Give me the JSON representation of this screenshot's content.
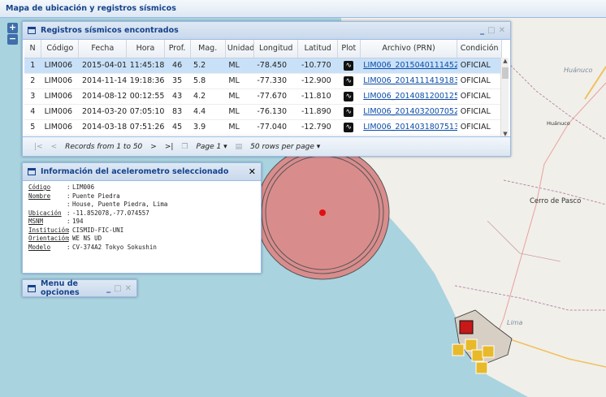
{
  "app": {
    "title": "Mapa de ubicación y registros sísmicos"
  },
  "map": {
    "zoom_in": "+",
    "zoom_out": "−",
    "labels": {
      "huanuco_region": "Huánuco",
      "huanuco_city": "Huánuco",
      "cerro_de_pasco": "Cerro de Pasco",
      "lima": "Lima"
    }
  },
  "grid_panel": {
    "title": "Registros sísmicos encontrados",
    "columns": [
      "N",
      "Código",
      "Fecha",
      "Hora",
      "Prof.",
      "Mag.",
      "Unidad",
      "Longitud",
      "Latitud",
      "Plot",
      "Archivo (PRN)",
      "Condición"
    ],
    "rows": [
      {
        "n": "1",
        "codigo": "LIM006",
        "fecha": "2015-04-01",
        "hora": "11:45:18",
        "prof": "46",
        "mag": "5.2",
        "unidad": "ML",
        "longitud": "-78.450",
        "latitud": "-10.770",
        "archivo": "LIM006_20150401114527",
        "condicion": "OFICIAL"
      },
      {
        "n": "2",
        "codigo": "LIM006",
        "fecha": "2014-11-14",
        "hora": "19:18:36",
        "prof": "35",
        "mag": "5.8",
        "unidad": "ML",
        "longitud": "-77.330",
        "latitud": "-12.900",
        "archivo": "LIM006_20141114191837",
        "condicion": "OFICIAL"
      },
      {
        "n": "3",
        "codigo": "LIM006",
        "fecha": "2014-08-12",
        "hora": "00:12:55",
        "prof": "43",
        "mag": "4.2",
        "unidad": "ML",
        "longitud": "-77.670",
        "latitud": "-11.810",
        "archivo": "LIM006_20140812001256",
        "condicion": "OFICIAL"
      },
      {
        "n": "4",
        "codigo": "LIM006",
        "fecha": "2014-03-20",
        "hora": "07:05:10",
        "prof": "83",
        "mag": "4.4",
        "unidad": "ML",
        "longitud": "-76.130",
        "latitud": "-11.890",
        "archivo": "LIM006_20140320070520",
        "condicion": "OFICIAL"
      },
      {
        "n": "5",
        "codigo": "LIM006",
        "fecha": "2014-03-18",
        "hora": "07:51:26",
        "prof": "45",
        "mag": "3.9",
        "unidad": "ML",
        "longitud": "-77.040",
        "latitud": "-12.790",
        "archivo": "LIM006_20140318075132",
        "condicion": "OFICIAL"
      }
    ],
    "pager": {
      "records": "Records from 1 to 50",
      "page": "Page 1",
      "rows_per_page": "50 rows per page"
    }
  },
  "info_panel": {
    "title": "Información del acelerometro seleccionado",
    "fields": [
      {
        "key": "Código",
        "value": "LIM006"
      },
      {
        "key": "Nombre",
        "value": "Puente Piedra"
      },
      {
        "key": "",
        "value": "House, Puente Piedra, Lima"
      },
      {
        "key": "Ubicación",
        "value": "-11.852078,-77.074557"
      },
      {
        "key": "MSNM",
        "value": "194"
      },
      {
        "key": "Institución",
        "value": "CISMID-FIC-UNI"
      },
      {
        "key": "Orientación",
        "value": "WE NS UD"
      },
      {
        "key": "Modelo",
        "value": "CV-374A2 Tokyo Sokushin"
      }
    ]
  },
  "menu_panel": {
    "title": "Menu de opciones"
  },
  "colors": {
    "header_text": "#15428b",
    "border": "#99bbe8",
    "selected_row": "#c9e1f8",
    "epicenter_fill": "#d98c8c",
    "marker": "#e8b92a"
  }
}
